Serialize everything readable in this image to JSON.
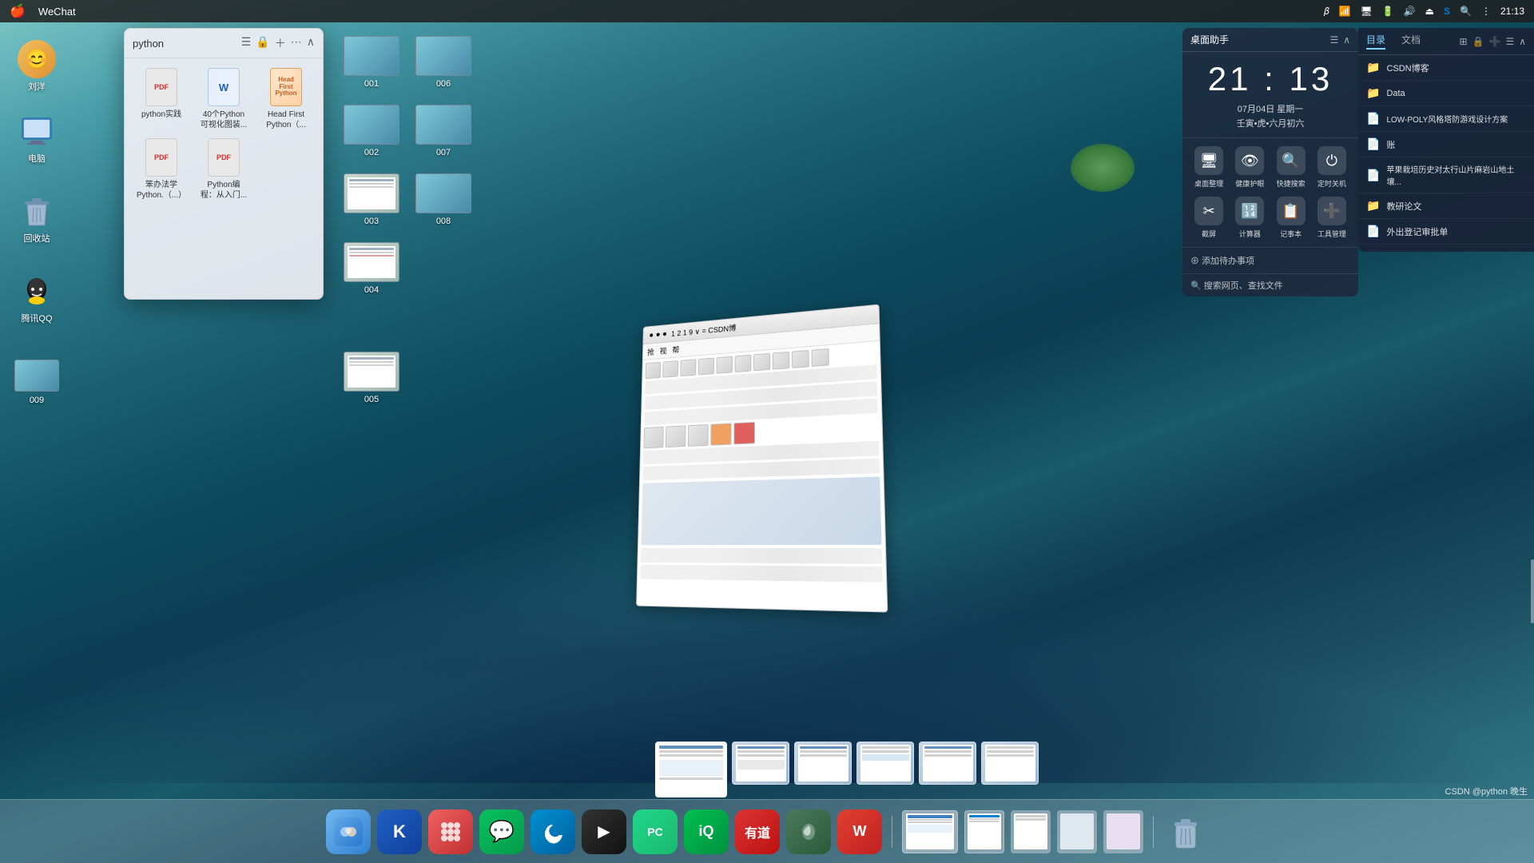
{
  "menubar": {
    "apple_logo": "🍎",
    "app_name": "WeChat",
    "time": "21:13",
    "icons": [
      "bluetooth",
      "wifi",
      "display",
      "battery",
      "volume",
      "eject",
      "skype",
      "search",
      "control-center"
    ]
  },
  "python_popup": {
    "title": "python",
    "files": [
      {
        "name": "python实践",
        "type": "pdf",
        "label": "python实践"
      },
      {
        "name": "40个Python可视化图装...",
        "type": "word",
        "label": "40个Python\n可视化图装..."
      },
      {
        "name": "Head First Python（...",
        "type": "book",
        "label": "Head First\nPython（..."
      },
      {
        "name": "笨办法学Python.（...）",
        "type": "pdf",
        "label": "笨办法学\nPython.（...）"
      },
      {
        "name": "Python编程：从入门...",
        "type": "pdf",
        "label": "Python编\n程：从入门..."
      }
    ]
  },
  "screen_items": [
    {
      "id": "001",
      "label": "001"
    },
    {
      "id": "006",
      "label": "006"
    },
    {
      "id": "002",
      "label": "002"
    },
    {
      "id": "007",
      "label": "007"
    },
    {
      "id": "003",
      "label": "003"
    },
    {
      "id": "008",
      "label": "008"
    },
    {
      "id": "004",
      "label": "004"
    },
    {
      "id": "005",
      "label": "005"
    }
  ],
  "desktop_icons": [
    {
      "id": "user",
      "label": "刘洋",
      "type": "avatar"
    },
    {
      "id": "computer",
      "label": "电脑",
      "type": "computer"
    },
    {
      "id": "trash",
      "label": "回收站",
      "type": "trash"
    },
    {
      "id": "qq",
      "label": "腾讯QQ",
      "type": "qq"
    },
    {
      "id": "009",
      "label": "009",
      "type": "screen"
    }
  ],
  "desktop_assistant": {
    "title": "桌面助手",
    "clock": "21 : 13",
    "date_line1": "07月04日  星期一",
    "date_line2": "壬寅•虎•六月初六",
    "icons": [
      {
        "label": "桌面整理",
        "icon": "🖥"
      },
      {
        "label": "健康护眼",
        "icon": "👁"
      },
      {
        "label": "快捷搜索",
        "icon": "🔍"
      },
      {
        "label": "定时关机",
        "icon": "⏻"
      }
    ],
    "icons2": [
      {
        "label": "截屏",
        "icon": "✂"
      },
      {
        "label": "计算器",
        "icon": "🔢"
      },
      {
        "label": "记事本",
        "icon": "📋"
      },
      {
        "label": "工具管理",
        "icon": "➕"
      }
    ],
    "add_todo": "⊕ 添加待办事项",
    "search": "🔍 搜索网页、查找文件"
  },
  "directory": {
    "title": "目录",
    "tabs": [
      "目录",
      "文档"
    ],
    "header_icons": [
      "⊞",
      "🔒",
      "➕",
      "☰",
      "⌃"
    ],
    "items": [
      {
        "name": "CSDN博客",
        "type": "folder"
      },
      {
        "name": "Data",
        "type": "folder"
      },
      {
        "name": "LOW-POLY风格塔防游戏设计方案",
        "type": "file"
      },
      {
        "name": "账",
        "type": "file"
      },
      {
        "name": "苹果栽培历史对太行山片麻岩山地土壤...",
        "type": "file"
      },
      {
        "name": "教研论文",
        "type": "folder"
      },
      {
        "name": "外出登记审批单",
        "type": "file"
      }
    ]
  },
  "csdn_window": {
    "title": "1 2 1 9 ∨ = CSDN博",
    "menu_items": [
      "抢",
      "视",
      "帮"
    ]
  },
  "dock": {
    "apps": [
      {
        "name": "finder",
        "icon": "🔵",
        "label": "Finder",
        "color": "#2080d0"
      },
      {
        "name": "kugou",
        "icon": "K",
        "label": "酷狗",
        "color": "#1a6fc4"
      },
      {
        "name": "launchpad",
        "icon": "🚀",
        "label": "启动台",
        "color": "#e04040"
      },
      {
        "name": "wechat",
        "icon": "💬",
        "label": "微信",
        "color": "#07c160"
      },
      {
        "name": "edge",
        "icon": "🌊",
        "label": "Edge",
        "color": "#0078d4"
      },
      {
        "name": "iqiyi-player",
        "icon": "▶",
        "label": "爱奇艺Player",
        "color": "#222"
      },
      {
        "name": "pycharm",
        "icon": "🔧",
        "label": "PyCharm",
        "color": "#21d789"
      },
      {
        "name": "iqiyi",
        "icon": "Q",
        "label": "爱奇艺",
        "color": "#00b140"
      },
      {
        "name": "youdao",
        "icon": "有",
        "label": "有道",
        "color": "#cc2222"
      },
      {
        "name": "flomo",
        "icon": "🌿",
        "label": "Flomo",
        "color": "#5a9a6a"
      },
      {
        "name": "wps",
        "icon": "W",
        "label": "WPS",
        "color": "#c8392b"
      }
    ],
    "preview_apps": [
      {
        "name": "finder-preview",
        "icon": "🔵"
      },
      {
        "name": "browser-preview",
        "icon": "🌊"
      },
      {
        "name": "wechat-preview",
        "icon": "💬"
      },
      {
        "name": "screen1-preview",
        "icon": "📷"
      },
      {
        "name": "screen2-preview",
        "icon": "📷"
      },
      {
        "name": "screen3-preview",
        "icon": "📷"
      },
      {
        "name": "screen4-preview",
        "icon": "📷"
      },
      {
        "name": "trash-dock",
        "icon": "🗑"
      }
    ],
    "status_text": "CSDN @python 晚生"
  }
}
